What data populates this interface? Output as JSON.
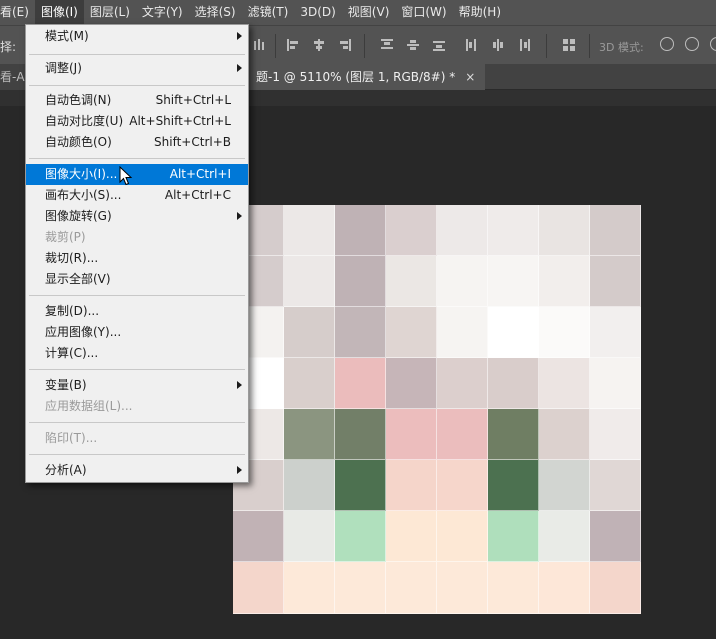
{
  "menubar": {
    "items": [
      {
        "label": "看(E)"
      },
      {
        "label": "图像(I)"
      },
      {
        "label": "图层(L)"
      },
      {
        "label": "文字(Y)"
      },
      {
        "label": "选择(S)"
      },
      {
        "label": "滤镜(T)"
      },
      {
        "label": "3D(D)"
      },
      {
        "label": "视图(V)"
      },
      {
        "label": "窗口(W)"
      },
      {
        "label": "帮助(H)"
      }
    ]
  },
  "options_bar": {
    "partial_label": "择:",
    "mode_3d_label": "3D 模式:"
  },
  "tabs": {
    "left_partial": "看-AI",
    "active_title": "题-1 @ 5110% (图层 1, RGB/8#) *",
    "close_glyph": "×"
  },
  "image_menu": {
    "items": [
      {
        "label": "模式(M)",
        "shortcut": "",
        "submenu": true,
        "disabled": false
      },
      {
        "label": "调整(J)",
        "shortcut": "",
        "submenu": true,
        "disabled": false
      },
      {
        "label": "自动色调(N)",
        "shortcut": "Shift+Ctrl+L",
        "submenu": false,
        "disabled": false
      },
      {
        "label": "自动对比度(U)",
        "shortcut": "Alt+Shift+Ctrl+L",
        "submenu": false,
        "disabled": false
      },
      {
        "label": "自动颜色(O)",
        "shortcut": "Shift+Ctrl+B",
        "submenu": false,
        "disabled": false
      },
      {
        "label": "图像大小(I)...",
        "shortcut": "Alt+Ctrl+I",
        "submenu": false,
        "disabled": false,
        "highlighted": true
      },
      {
        "label": "画布大小(S)...",
        "shortcut": "Alt+Ctrl+C",
        "submenu": false,
        "disabled": false
      },
      {
        "label": "图像旋转(G)",
        "shortcut": "",
        "submenu": true,
        "disabled": false
      },
      {
        "label": "裁剪(P)",
        "shortcut": "",
        "submenu": false,
        "disabled": true
      },
      {
        "label": "裁切(R)...",
        "shortcut": "",
        "submenu": false,
        "disabled": false
      },
      {
        "label": "显示全部(V)",
        "shortcut": "",
        "submenu": false,
        "disabled": false
      },
      {
        "label": "复制(D)...",
        "shortcut": "",
        "submenu": false,
        "disabled": false
      },
      {
        "label": "应用图像(Y)...",
        "shortcut": "",
        "submenu": false,
        "disabled": false
      },
      {
        "label": "计算(C)...",
        "shortcut": "",
        "submenu": false,
        "disabled": false
      },
      {
        "label": "变量(B)",
        "shortcut": "",
        "submenu": true,
        "disabled": false
      },
      {
        "label": "应用数据组(L)...",
        "shortcut": "",
        "submenu": false,
        "disabled": true
      },
      {
        "label": "陷印(T)...",
        "shortcut": "",
        "submenu": false,
        "disabled": true
      },
      {
        "label": "分析(A)",
        "shortcut": "",
        "submenu": true,
        "disabled": false
      }
    ]
  },
  "canvas": {
    "pixel_colors": [
      [
        "#d5cccc",
        "#ece8e7",
        "#bfb2b5",
        "#dacfcf",
        "#ede9e8",
        "#efebea",
        "#e9e4e2",
        "#d4cbca"
      ],
      [
        "#d5cccc",
        "#ece8e7",
        "#bfb2b5",
        "#ebe7e4",
        "#f6f4f2",
        "#f7f5f3",
        "#f2eeec",
        "#d4cbca"
      ],
      [
        "#f4f2f0",
        "#d6cdcb",
        "#c2b6b8",
        "#dfd5d2",
        "#f6f4f2",
        "#ffffff",
        "#fbfaf9",
        "#f2efee"
      ],
      [
        "#ffffff",
        "#d9cfcc",
        "#ebbcbc",
        "#c6b5b8",
        "#dccfcd",
        "#d9cdcb",
        "#ece4e2",
        "#f6f3f1"
      ],
      [
        "#ede8e6",
        "#8b9580",
        "#727f68",
        "#ecbdbd",
        "#ebbdbd",
        "#6f7e63",
        "#dcd1ce",
        "#f0ebea"
      ],
      [
        "#d9cfcd",
        "#ccd0cc",
        "#4d7150",
        "#f5d5ca",
        "#f6d6cb",
        "#4c7150",
        "#d2d5d1",
        "#e0d7d5"
      ],
      [
        "#c1b2b5",
        "#e8eae6",
        "#b0e0bd",
        "#fde8d5",
        "#fde8d5",
        "#afdfbc",
        "#e9ebe7",
        "#c0b2b6"
      ],
      [
        "#f4d6cb",
        "#fde9d9",
        "#fde9d9",
        "#fde9d9",
        "#fde9d9",
        "#fde9d9",
        "#fde7d8",
        "#f4d6cb"
      ]
    ]
  }
}
